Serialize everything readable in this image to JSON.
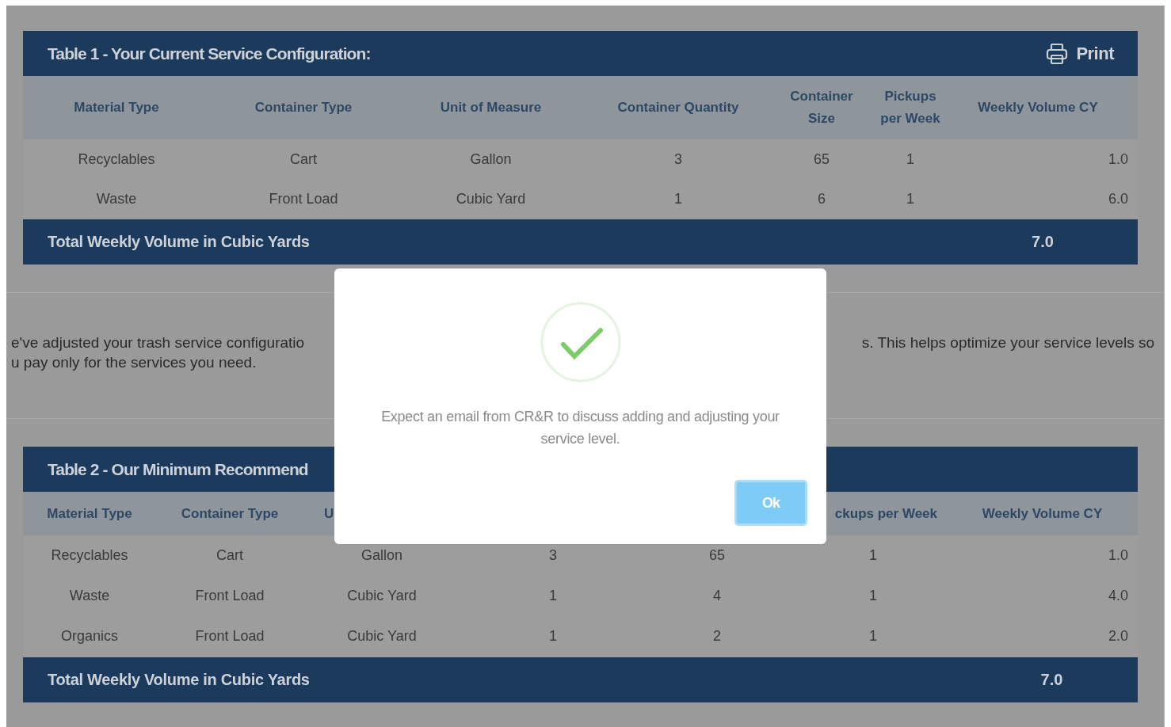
{
  "tables": [
    {
      "title": "Table 1 - Your Current Service Configuration:",
      "print_button": {
        "label": "Print"
      },
      "columns": [
        "Material Type",
        "Container Type",
        "Unit of Measure",
        "Container Quantity",
        "Container Size",
        "Pickups per Week",
        "Weekly Volume CY"
      ],
      "rows": [
        [
          "Recyclables",
          "Cart",
          "Gallon",
          "3",
          "65",
          "1",
          "1.0"
        ],
        [
          "Waste",
          "Front Load",
          "Cubic Yard",
          "1",
          "6",
          "1",
          "6.0"
        ]
      ],
      "total": {
        "label": "Total Weekly Volume in Cubic Yards",
        "value": "7.0"
      }
    },
    {
      "title": "Table 2 - Our Minimum Recommend",
      "columns": [
        "Material Type",
        "Container Type",
        "U",
        "",
        "",
        "ckups per Week",
        "Weekly Volume CY"
      ],
      "rows": [
        [
          "Recyclables",
          "Cart",
          "Gallon",
          "3",
          "65",
          "1",
          "1.0"
        ],
        [
          "Waste",
          "Front Load",
          "Cubic Yard",
          "1",
          "4",
          "1",
          "4.0"
        ],
        [
          "Organics",
          "Front Load",
          "Cubic Yard",
          "1",
          "2",
          "1",
          "2.0"
        ]
      ],
      "total": {
        "label": "Total Weekly Volume in Cubic Yards",
        "value": "7.0"
      }
    }
  ],
  "notice": {
    "line_1_left": "e've adjusted your trash service configuratio",
    "line_1_right": "s. This helps optimize your service levels so",
    "line_2_left": "u pay only for the services you need."
  },
  "dialog": {
    "message": "Expect an email from CR&R to discuss adding and adjusting your service level.",
    "ok_button": "Ok"
  }
}
